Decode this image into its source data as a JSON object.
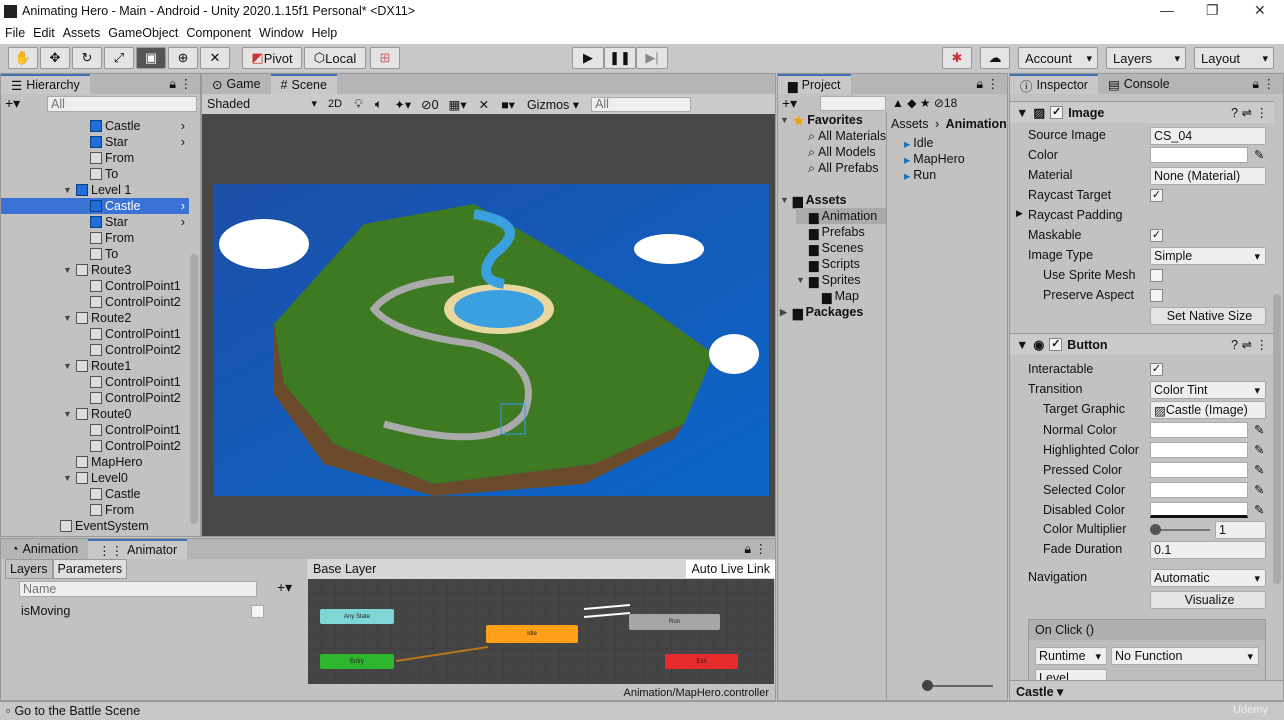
{
  "window": {
    "title": "Animating Hero - Main - Android - Unity 2020.1.15f1 Personal* <DX11>"
  },
  "menu": [
    "File",
    "Edit",
    "Assets",
    "GameObject",
    "Component",
    "Window",
    "Help"
  ],
  "toolbar": {
    "pivot": "Pivot",
    "local": "Local",
    "account": "Account",
    "layers": "Layers",
    "layout": "Layout"
  },
  "hierarchy": {
    "tab": "Hierarchy",
    "search_placeholder": "All",
    "items": [
      {
        "label": "Castle",
        "indent": 3,
        "icon": "cube-blue"
      },
      {
        "label": "Star",
        "indent": 3,
        "icon": "cube-blue"
      },
      {
        "label": "From",
        "indent": 3,
        "icon": "cube"
      },
      {
        "label": "To",
        "indent": 3,
        "icon": "cube"
      },
      {
        "label": "Level 1",
        "indent": 2,
        "icon": "cube-blue",
        "expand": true
      },
      {
        "label": "Castle",
        "indent": 3,
        "icon": "cube-blue",
        "selected": true
      },
      {
        "label": "Star",
        "indent": 3,
        "icon": "cube-blue"
      },
      {
        "label": "From",
        "indent": 3,
        "icon": "cube"
      },
      {
        "label": "To",
        "indent": 3,
        "icon": "cube"
      },
      {
        "label": "Route3",
        "indent": 2,
        "icon": "cube",
        "expand": true
      },
      {
        "label": "ControlPoint1",
        "indent": 3,
        "icon": "cube"
      },
      {
        "label": "ControlPoint2",
        "indent": 3,
        "icon": "cube"
      },
      {
        "label": "Route2",
        "indent": 2,
        "icon": "cube",
        "expand": true
      },
      {
        "label": "ControlPoint1",
        "indent": 3,
        "icon": "cube"
      },
      {
        "label": "ControlPoint2",
        "indent": 3,
        "icon": "cube"
      },
      {
        "label": "Route1",
        "indent": 2,
        "icon": "cube",
        "expand": true
      },
      {
        "label": "ControlPoint1",
        "indent": 3,
        "icon": "cube"
      },
      {
        "label": "ControlPoint2",
        "indent": 3,
        "icon": "cube"
      },
      {
        "label": "Route0",
        "indent": 2,
        "icon": "cube",
        "expand": true
      },
      {
        "label": "ControlPoint1",
        "indent": 3,
        "icon": "cube"
      },
      {
        "label": "ControlPoint2",
        "indent": 3,
        "icon": "cube"
      },
      {
        "label": "MapHero",
        "indent": 2,
        "icon": "cube"
      },
      {
        "label": "Level0",
        "indent": 2,
        "icon": "cube",
        "expand": true
      },
      {
        "label": "Castle",
        "indent": 3,
        "icon": "cube"
      },
      {
        "label": "From",
        "indent": 3,
        "icon": "cube"
      },
      {
        "label": "EventSystem",
        "indent": 1,
        "icon": "cube"
      }
    ]
  },
  "scene": {
    "tabs": [
      "Game",
      "Scene"
    ],
    "shading": "Shaded",
    "mode2d": "2D",
    "hidden_count": "0",
    "gizmos": "Gizmos",
    "search_placeholder": "All"
  },
  "project": {
    "tab": "Project",
    "count": "18",
    "favorites": "Favorites",
    "fav_items": [
      "All Materials",
      "All Models",
      "All Prefabs"
    ],
    "assets": "Assets",
    "asset_folders": [
      "Animation",
      "Prefabs",
      "Scenes",
      "Scripts",
      "Sprites"
    ],
    "sprite_sub": "Map",
    "packages": "Packages",
    "breadcrumb": [
      "Assets",
      "Animation"
    ],
    "files": [
      "Idle",
      "MapHero",
      "Run"
    ]
  },
  "inspector": {
    "tabs": [
      "Inspector",
      "Console"
    ],
    "image": {
      "title": "Image",
      "rows": [
        {
          "label": "Source Image",
          "value": "CS_04"
        },
        {
          "label": "Color",
          "value": ""
        },
        {
          "label": "Material",
          "value": "None (Material)"
        },
        {
          "label": "Raycast Target",
          "value": "✓"
        },
        {
          "label": "Raycast Padding",
          "value": ""
        },
        {
          "label": "Maskable",
          "value": "✓"
        },
        {
          "label": "Image Type",
          "value": "Simple"
        },
        {
          "label": "Use Sprite Mesh",
          "value": ""
        },
        {
          "label": "Preserve Aspect",
          "value": ""
        }
      ],
      "set_native": "Set Native Size"
    },
    "button": {
      "title": "Button",
      "interactable": "Interactable",
      "transition": "Transition",
      "transition_value": "Color Tint",
      "target_graphic": "Target Graphic",
      "target_value": "Castle (Image)",
      "colors": [
        "Normal Color",
        "Highlighted Color",
        "Pressed Color",
        "Selected Color",
        "Disabled Color"
      ],
      "multiplier": "Color Multiplier",
      "multiplier_value": "1",
      "multiplier_fraction": 0.0,
      "fade": "Fade Duration",
      "fade_value": "0.1",
      "navigation": "Navigation",
      "navigation_value": "Automatic",
      "visualize": "Visualize",
      "onclick": "On Click ()",
      "runtime": "Runtime",
      "function": "No Function",
      "object": "Level"
    }
  },
  "animation": {
    "tabs": [
      "Animation",
      "Animator"
    ],
    "subtabs": [
      "Layers",
      "Parameters"
    ],
    "name_placeholder": "Name",
    "param": "isMoving",
    "layer": "Base Layer",
    "live_link": "Auto Live Link",
    "path": "Animation/MapHero.controller",
    "states": {
      "any": "Any State",
      "entry": "Entry",
      "idle": "Idle",
      "run": "Run",
      "exit": "Exit"
    }
  },
  "preview": {
    "object": "Castle"
  },
  "status": "Go to the Battle Scene",
  "watermark": "Udemy"
}
